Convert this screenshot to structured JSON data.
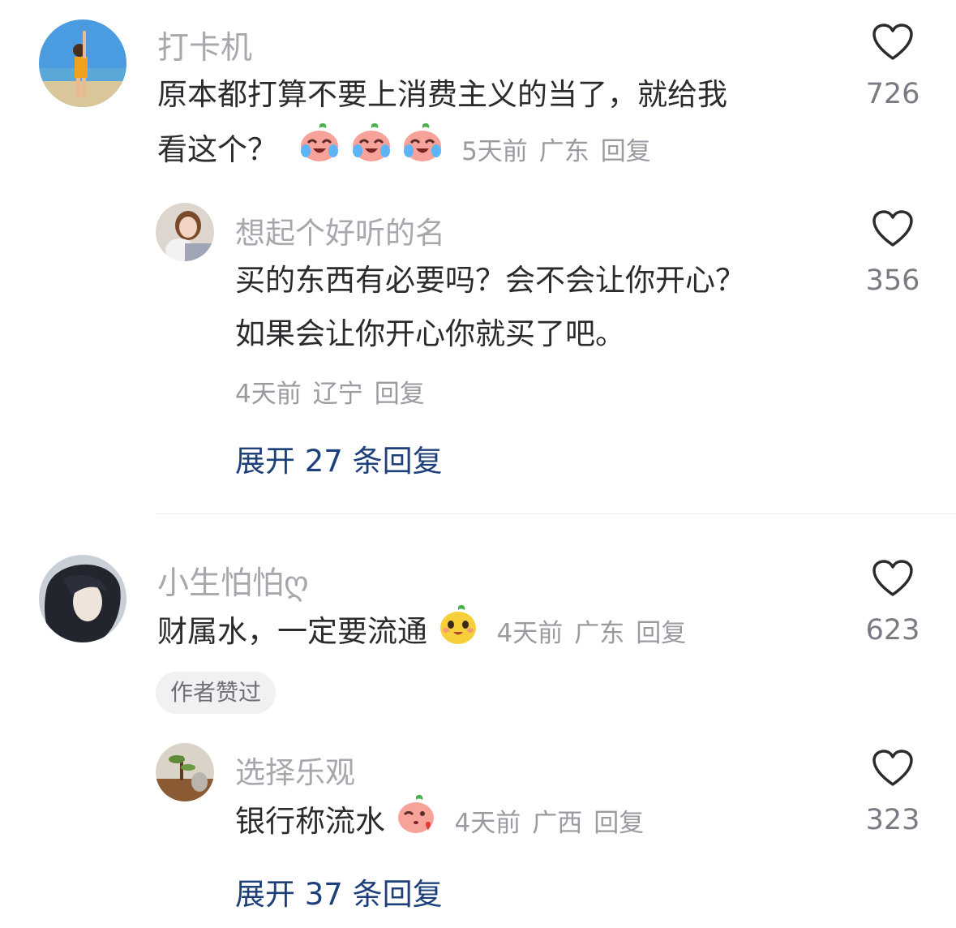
{
  "comments": [
    {
      "username": "打卡机",
      "text_line1": "原本都打算不要上消费主义的当了，就给我",
      "text_line2": "看这个？",
      "emojis": [
        "crying-laughing-peach-emoji",
        "crying-laughing-peach-emoji",
        "crying-laughing-peach-emoji"
      ],
      "time": "5天前",
      "location": "广东",
      "reply_label": "回复",
      "likes": "726",
      "reply": {
        "username": "想起个好听的名",
        "text_line1": "买的东西有必要吗？会不会让你开心？",
        "text_line2": "如果会让你开心你就买了吧。",
        "time": "4天前",
        "location": "辽宁",
        "reply_label": "回复",
        "likes": "356"
      },
      "expand_label": "展开 27 条回复"
    },
    {
      "username": "小生怕怕ღ",
      "text": "财属水，一定要流通",
      "emojis": [
        "happy-mango-emoji"
      ],
      "time": "4天前",
      "location": "广东",
      "reply_label": "回复",
      "likes": "623",
      "author_badge": "作者赞过",
      "reply": {
        "username": "选择乐观",
        "text": "银行称流水",
        "emojis": [
          "kiss-peach-emoji"
        ],
        "time": "4天前",
        "location": "广西",
        "reply_label": "回复",
        "likes": "323"
      },
      "expand_label": "展开 37 条回复"
    }
  ],
  "colors": {
    "username": "#a7a7ae",
    "text": "#2b2b2f",
    "meta": "#9a9aa1",
    "expand": "#1d3f7a"
  }
}
